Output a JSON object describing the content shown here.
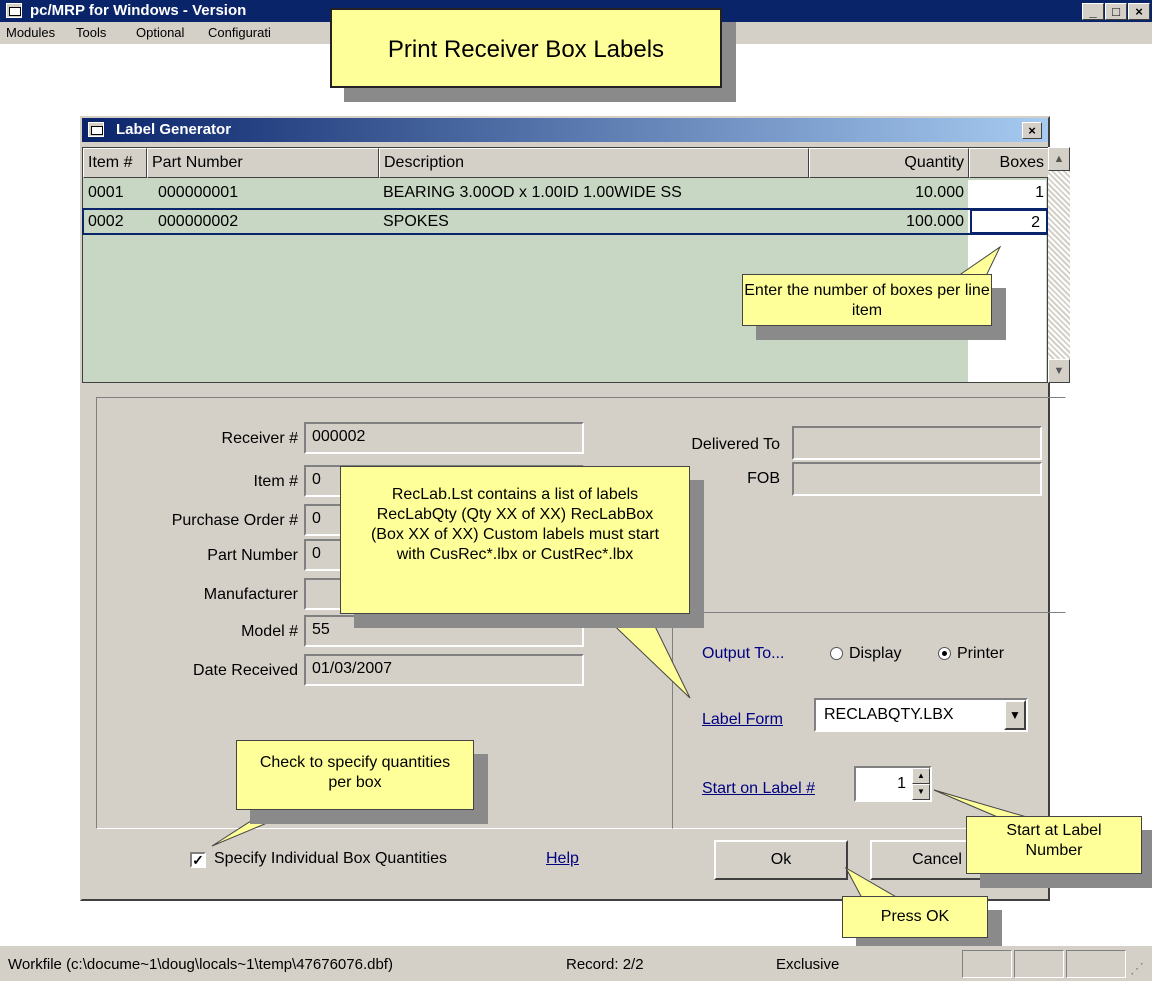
{
  "app": {
    "title": "pc/MRP for Windows - Version",
    "menu": [
      "Modules",
      "Tools",
      "Optional",
      "Configurati"
    ]
  },
  "banner": "Print Receiver Box Labels",
  "dialog": {
    "title": "Label Generator",
    "grid": {
      "headers": [
        "Item #",
        "Part Number",
        "Description",
        "Quantity",
        "Boxes"
      ],
      "rows": [
        {
          "item": "0001",
          "part": "000000001",
          "desc": "BEARING 3.00OD x 1.00ID 1.00WIDE SS",
          "qty": "10.000",
          "boxes": "1"
        },
        {
          "item": "0002",
          "part": "000000002",
          "desc": "SPOKES",
          "qty": "100.000",
          "boxes": "2"
        }
      ]
    },
    "form": {
      "receiver_label": "Receiver #",
      "receiver_value": "000002",
      "item_label": "Item #",
      "item_value": "0",
      "po_label": "Purchase Order #",
      "po_value": "0",
      "part_label": "Part Number",
      "part_value": "0",
      "mfr_label": "Manufacturer",
      "mfr_value": "",
      "model_label": "Model #",
      "model_value": "55",
      "date_label": "Date Received",
      "date_value": "01/03/2007",
      "delivered_label": "Delivered To",
      "delivered_value": "",
      "fob_label": "FOB",
      "fob_value": ""
    },
    "output": {
      "label": "Output To...",
      "display": "Display",
      "printer": "Printer",
      "selected": "Printer"
    },
    "label_form": {
      "label": "Label Form",
      "value": "RECLABQTY.LBX"
    },
    "start_label": {
      "label": "Start on Label #",
      "value": "1"
    },
    "specify_box": {
      "label": "Specify Individual Box Quantities",
      "checked": true
    },
    "help": "Help",
    "ok": "Ok",
    "cancel": "Cancel"
  },
  "callouts": {
    "boxes": "Enter the number of boxes per line item",
    "reclab": "RecLab.Lst contains a list of labels RecLabQty (Qty XX of  XX) RecLabBox (Box XX of XX) Custom labels must start with CusRec*.lbx or CustRec*.lbx",
    "check": "Check to specify quantities per box",
    "start": "Start at Label Number",
    "ok": "Press OK"
  },
  "status": {
    "workfile": "Workfile (c:\\docume~1\\doug\\locals~1\\temp\\47676076.dbf)",
    "record": "Record: 2/2",
    "mode": "Exclusive"
  }
}
